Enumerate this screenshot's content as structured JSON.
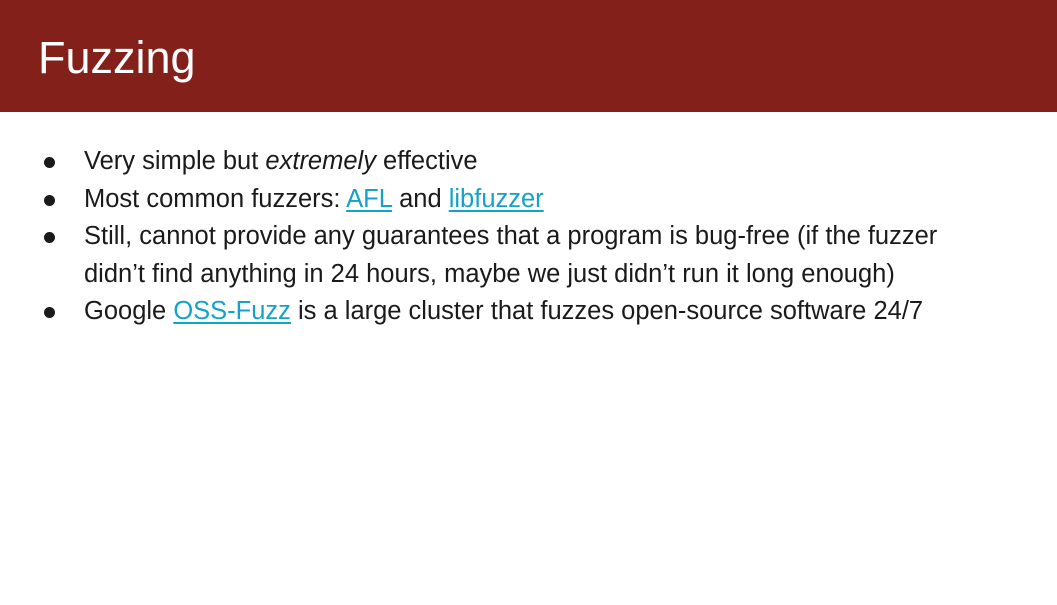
{
  "slide": {
    "title": "Fuzzing",
    "bullets": [
      {
        "pre": "Very simple but ",
        "em": "extremely",
        "post": " effective"
      },
      {
        "pre": "Most common fuzzers: ",
        "link1": "AFL",
        "mid": " and ",
        "link2": "libfuzzer"
      },
      {
        "line1": "Still, cannot provide any guarantees that a program is bug-free (if the fuzzer",
        "line2": "didn’t find anything in 24 hours, maybe we just didn’t run it long enough)"
      },
      {
        "pre": "Google ",
        "link": "OSS-Fuzz",
        "post": " is a large cluster that fuzzes open-source software 24/7"
      }
    ]
  },
  "colors": {
    "title_bar": "#822019",
    "link": "#14a3c8",
    "text": "#1a1a1a"
  },
  "icons": {
    "bullet": "bullet-dot-icon"
  }
}
